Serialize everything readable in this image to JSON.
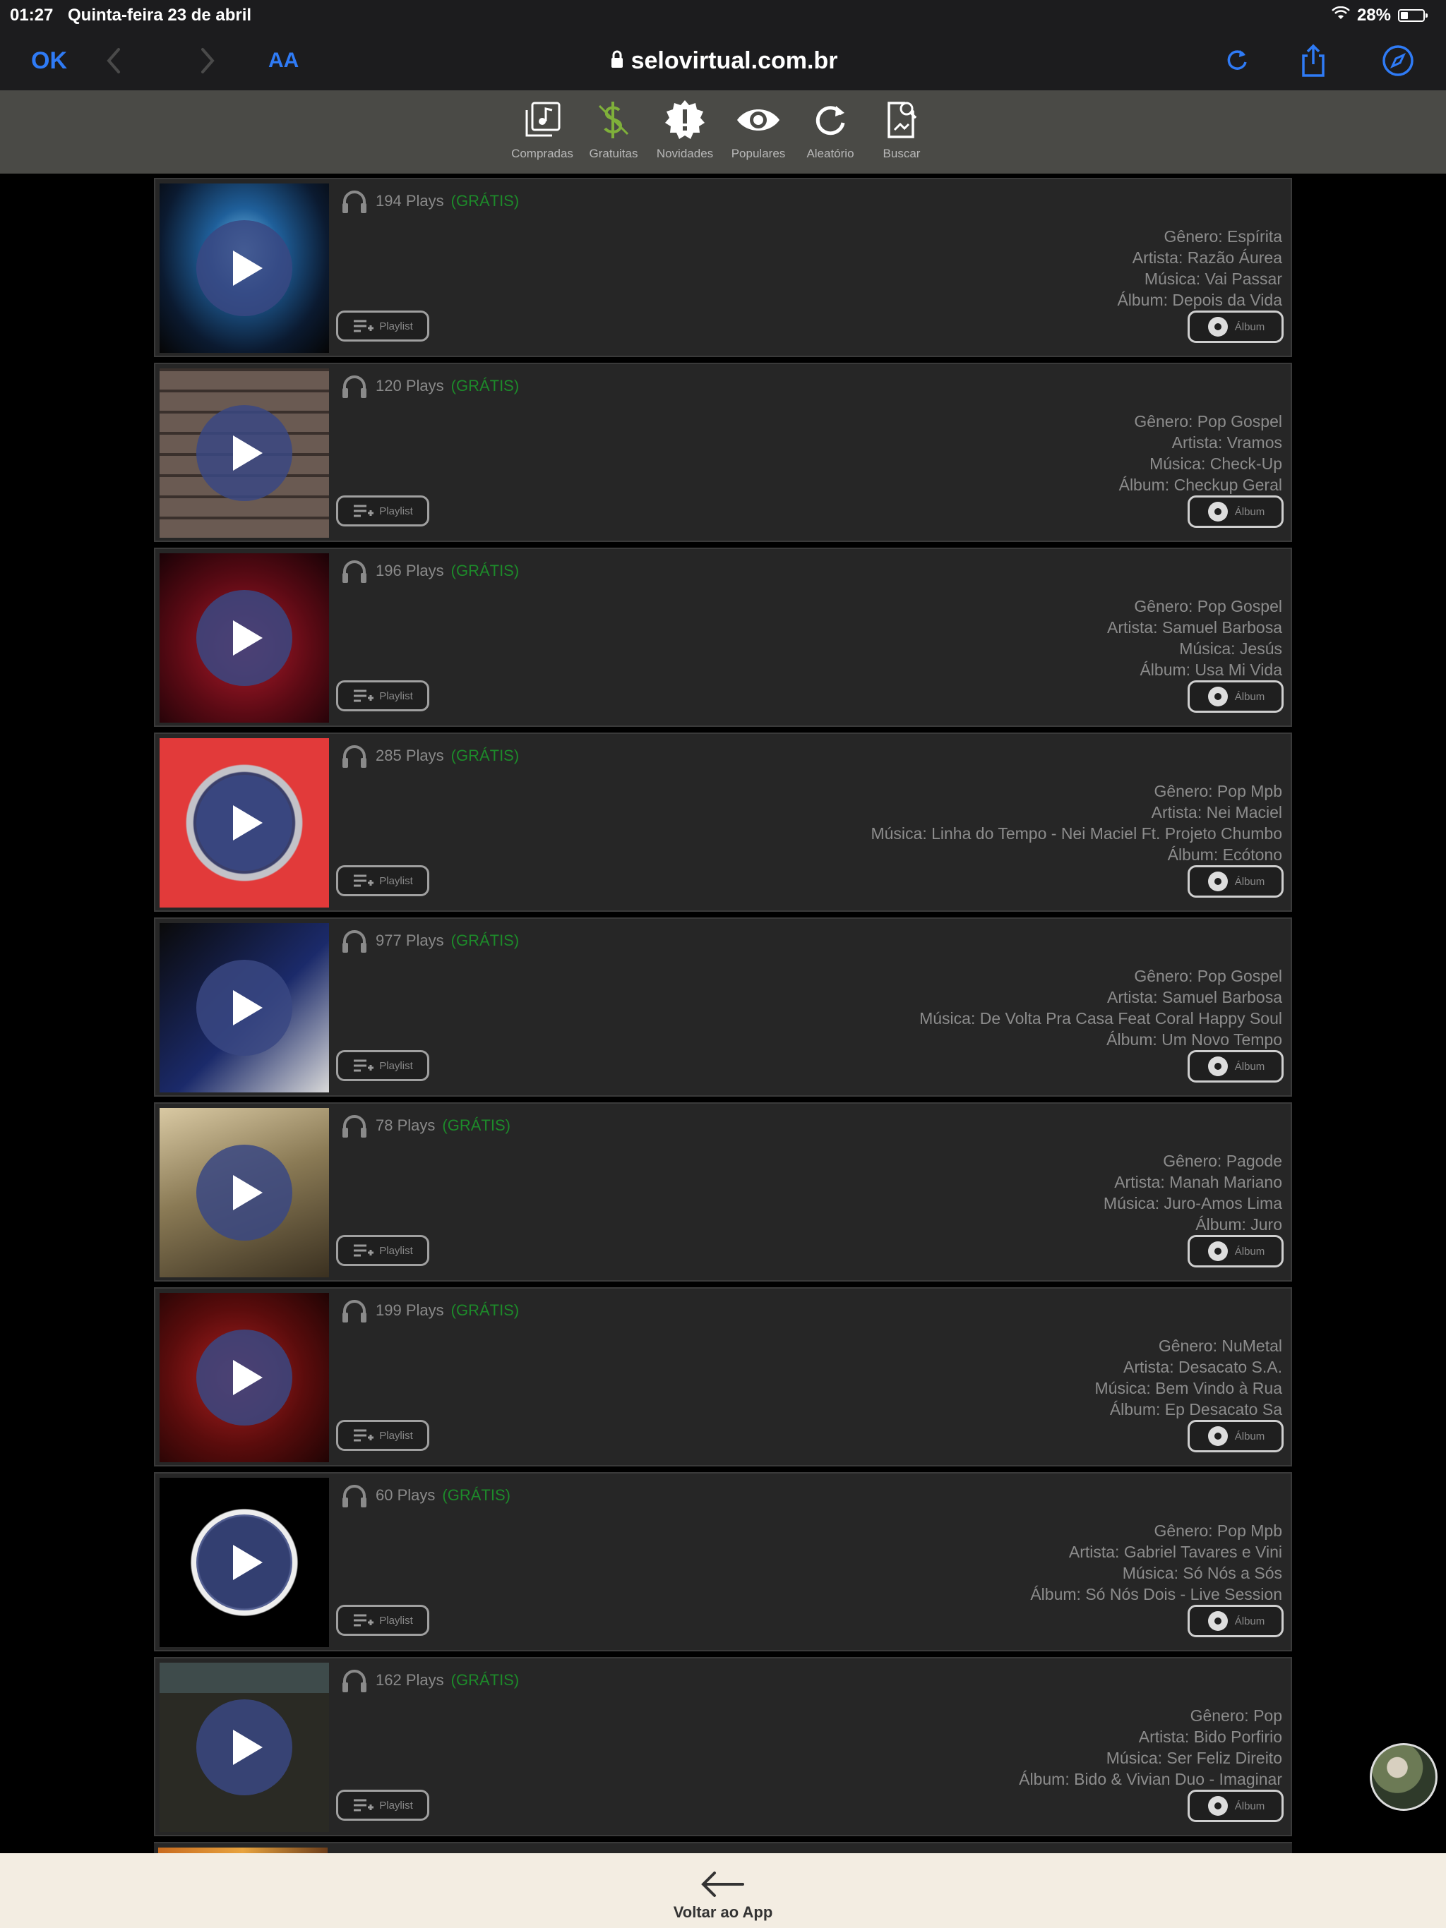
{
  "status_bar": {
    "time": "01:27",
    "date": "Quinta-feira 23 de abril",
    "battery": "28%",
    "battery_level": 0.28
  },
  "safari": {
    "ok_label": "OK",
    "text_size_label": "AA",
    "url": "selovirtual.com.br"
  },
  "toolbar": {
    "items": [
      {
        "label": "Compradas",
        "icon": "purchased-music-icon"
      },
      {
        "label": "Gratuitas",
        "icon": "free-dollar-icon"
      },
      {
        "label": "Novidades",
        "icon": "new-badge-icon"
      },
      {
        "label": "Populares",
        "icon": "eye-icon"
      },
      {
        "label": "Aleatório",
        "icon": "shuffle-refresh-icon"
      },
      {
        "label": "Buscar",
        "icon": "search-icon"
      }
    ],
    "accent_color": "#7fb03a"
  },
  "labels": {
    "playlist": "Playlist",
    "album": "Álbum",
    "free": "(GRÁTIS)"
  },
  "tracks": [
    {
      "plays": "194 Plays",
      "genre": "Gênero: Espírita",
      "artist": "Artista: Razão Áurea",
      "song": "Música: Vai Passar",
      "album": "Álbum: Depois da Vida"
    },
    {
      "plays": "120 Plays",
      "genre": "Gênero: Pop Gospel",
      "artist": "Artista: Vramos",
      "song": "Música: Check-Up",
      "album": "Álbum: Checkup Geral"
    },
    {
      "plays": "196 Plays",
      "genre": "Gênero: Pop Gospel",
      "artist": "Artista: Samuel Barbosa",
      "song": "Música: Jesús",
      "album": "Álbum: Usa Mi Vida"
    },
    {
      "plays": "285 Plays",
      "genre": "Gênero: Pop Mpb",
      "artist": "Artista: Nei Maciel",
      "song": "Música: Linha do Tempo - Nei Maciel Ft. Projeto Chumbo",
      "album": "Álbum: Ecótono"
    },
    {
      "plays": "977 Plays",
      "genre": "Gênero: Pop Gospel",
      "artist": "Artista: Samuel Barbosa",
      "song": "Música: De Volta Pra Casa Feat Coral Happy Soul",
      "album": "Álbum: Um Novo Tempo"
    },
    {
      "plays": "78 Plays",
      "genre": "Gênero: Pagode",
      "artist": "Artista: Manah Mariano",
      "song": "Música: Juro-Amos Lima",
      "album": "Álbum: Juro"
    },
    {
      "plays": "199 Plays",
      "genre": "Gênero: NuMetal",
      "artist": "Artista: Desacato S.A.",
      "song": "Música: Bem Vindo à Rua",
      "album": "Álbum: Ep Desacato Sa"
    },
    {
      "plays": "60 Plays",
      "genre": "Gênero: Pop Mpb",
      "artist": "Artista: Gabriel Tavares e Vini",
      "song": "Música: Só Nós a Sós",
      "album": "Álbum: Só Nós Dois - Live Session"
    },
    {
      "plays": "162 Plays",
      "genre": "Gênero: Pop",
      "artist": "Artista: Bido Porfirio",
      "song": "Música: Ser Feliz Direito",
      "album": "Álbum: Bido & Vivian Duo - Imaginar"
    }
  ],
  "bottom_bar": {
    "back_label": "Voltar ao App"
  }
}
